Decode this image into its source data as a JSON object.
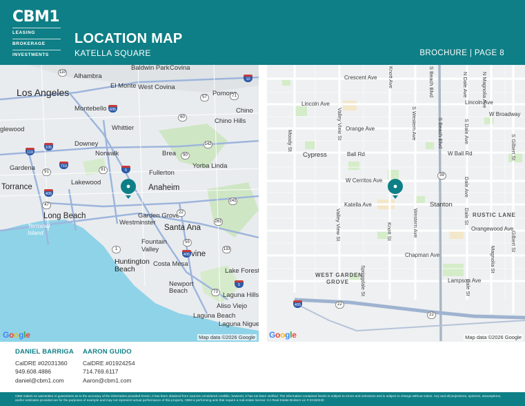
{
  "brand": {
    "name": "CBM1",
    "lines": [
      "LEASING",
      "BROKERAGE",
      "INVESTMENTS"
    ]
  },
  "header": {
    "title": "LOCATION MAP",
    "subtitle": "KATELLA SQUARE",
    "page": "BROCHURE | PAGE 8"
  },
  "map_left": {
    "labels": {
      "los_angeles": "Los Angeles",
      "alhambra": "Alhambra",
      "baldwin_park": "Baldwin Park",
      "covina": "Covina",
      "el_monte": "El Monte",
      "west_covina": "West Covina",
      "pomona": "Pomona",
      "montebello": "Montebello",
      "chino": "Chino",
      "whittier": "Whittier",
      "chino_hills": "Chino Hills",
      "inglewood": "glewood",
      "downey": "Downey",
      "norwalk": "Norwalk",
      "brea": "Brea",
      "yorba_linda": "Yorba Linda",
      "gardena": "Gardena",
      "fullerton": "Fullerton",
      "torrance": "Torrance",
      "lakewood": "Lakewood",
      "anaheim": "Anaheim",
      "long_beach": "Long Beach",
      "garden_grove": "Garden Grove",
      "westminster": "Westminster",
      "santa_ana": "Santa Ana",
      "terminal_island": "Terminal\nIsland",
      "fountain_valley": "Fountain\nValley",
      "irvine": "Irvine",
      "huntington_beach": "Huntington\nBeach",
      "costa_mesa": "Costa Mesa",
      "lake_forest": "Lake Forest",
      "newport_beach": "Newport\nBeach",
      "laguna_hills": "Laguna Hills",
      "aliso_viejo": "Aliso Viejo",
      "laguna_beach": "Laguna Beach",
      "laguna_niguel": "Laguna Niguel"
    },
    "shields": [
      "110",
      "10",
      "60",
      "57",
      "71",
      "605",
      "142",
      "90",
      "91",
      "5",
      "710",
      "105",
      "110",
      "91",
      "22",
      "405",
      "47",
      "241",
      "261",
      "1",
      "55",
      "133",
      "405",
      "73",
      "5"
    ],
    "google": "Google",
    "map_data": "Map data ©2026 Google"
  },
  "map_right": {
    "labels": {
      "crescent": "Crescent Ave",
      "lincoln1": "Lincoln Ave",
      "lincoln2": "Lincoln Ave",
      "broadway": "W Broadway",
      "orange": "Orange Ave",
      "ball": "Ball Rd",
      "wball": "W Ball Rd",
      "cypress": "Cypress",
      "cerritos": "W Cerritos Ave",
      "katella": "Katella Ave",
      "stanton": "Stanton",
      "rustic": "RUSTIC LANE",
      "orangewood": "Orangewood Ave",
      "chapman": "Chapman Ave",
      "wgg1": "WEST GARDEN",
      "wgg2": "GROVE",
      "lampson": "Lampson Ave",
      "knott_top": "Knott Ave",
      "beach": "S Beach Blvd",
      "ndale": "N Dale Ave",
      "magnolia": "N Magnolia Ave",
      "gilbert": "S Gilbert St",
      "valley_view": "Valley View St",
      "moody": "Moody St",
      "western": "S Western Ave",
      "sbeach": "S Beach Blvd",
      "sdale": "S Dale Ave",
      "dale1": "Dale Ave",
      "dale2": "Dale St",
      "western2": "Western Ave",
      "valley2": "Valley View St",
      "knott2": "Knott St",
      "springdale": "Springdale St",
      "gilbert2": "Gilbert St",
      "magnolia2": "Magnolia St",
      "dale3": "Dale St"
    },
    "shields": [
      "39",
      "405",
      "22",
      "22"
    ],
    "google": "Google",
    "map_data": "Map data ©2026 Google"
  },
  "contacts": [
    {
      "name": "DANIEL BARRIGA",
      "license": "CalDRE #02031360",
      "phone": "949.608.4886",
      "email": "daniel@cbm1.com"
    },
    {
      "name": "AARON GUIDO",
      "license": "CalDRE #01924254",
      "phone": "714.769.6117",
      "email": "Aaron@cbm1.com"
    }
  ],
  "footer": "CBM makes no warranties or guarantees as to the accuracy of the information provided herein, it has been obtained from sources considered credible, however, it has not been verified. The information contained herein is subject to errors and omissions and is subject to change without notice. Any and all projections, opinions, assumptions, and/or estimates provided are for the purposes of example and may not represent actual performance of this property. CBM is performing acts that require a real estate license: CA Real Estate Brokers Lic # 02150240",
  "colors": {
    "brand": "#0e7f86",
    "water": "#8fd3e8",
    "park": "#c8e6c0",
    "highway": "#8aa8d4"
  }
}
